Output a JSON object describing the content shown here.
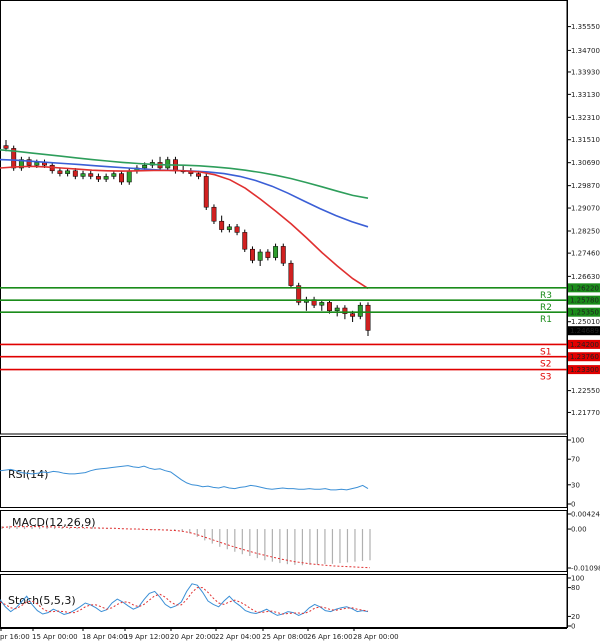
{
  "chart_data": {
    "type": "candlestick",
    "price_axis": {
      "ylim": [
        1.21,
        1.365
      ],
      "ticks": [
        "1.35550",
        "1.34700",
        "1.33930",
        "1.33130",
        "1.32310",
        "1.31510",
        "1.30690",
        "1.29870",
        "1.29070",
        "1.28250",
        "1.27460",
        "1.26630",
        "1.25010",
        "1.22550",
        "1.21770"
      ]
    },
    "time_labels": [
      "pr 16:00",
      "15 Apr 00:00",
      "18 Apr 04:00",
      "19 Apr 12:00",
      "20 Apr 20:00",
      "22 Apr 04:00",
      "25 Apr 08:00",
      "26 Apr 16:00",
      "28 Apr 00:00"
    ],
    "current_price": "1.24689",
    "levels": [
      {
        "name": "R3",
        "value": 1.2622,
        "label": "1.26220",
        "color": "#1a8c1a"
      },
      {
        "name": "R2",
        "value": 1.2578,
        "label": "1.25780",
        "color": "#1a8c1a"
      },
      {
        "name": "R1",
        "value": 1.2535,
        "label": "1.25350",
        "color": "#1a8c1a"
      },
      {
        "name": "S1",
        "value": 1.242,
        "label": "1.24200",
        "color": "#e00000"
      },
      {
        "name": "S2",
        "value": 1.2376,
        "label": "1.23760",
        "color": "#e00000"
      },
      {
        "name": "S3",
        "value": 1.233,
        "label": "1.23300",
        "color": "#e00000"
      }
    ],
    "candles": [
      [
        1.313,
        1.315,
        1.311,
        1.312
      ],
      [
        1.312,
        1.313,
        1.304,
        1.305
      ],
      [
        1.305,
        1.309,
        1.304,
        1.308
      ],
      [
        1.308,
        1.309,
        1.305,
        1.306
      ],
      [
        1.306,
        1.308,
        1.305,
        1.307
      ],
      [
        1.307,
        1.308,
        1.305,
        1.306
      ],
      [
        1.306,
        1.307,
        1.303,
        1.304
      ],
      [
        1.304,
        1.305,
        1.302,
        1.303
      ],
      [
        1.303,
        1.305,
        1.302,
        1.304
      ],
      [
        1.304,
        1.305,
        1.301,
        1.302
      ],
      [
        1.302,
        1.304,
        1.301,
        1.303
      ],
      [
        1.303,
        1.304,
        1.301,
        1.302
      ],
      [
        1.302,
        1.303,
        1.3,
        1.301
      ],
      [
        1.301,
        1.303,
        1.3,
        1.302
      ],
      [
        1.302,
        1.304,
        1.301,
        1.303
      ],
      [
        1.303,
        1.304,
        1.299,
        1.3
      ],
      [
        1.3,
        1.305,
        1.299,
        1.304
      ],
      [
        1.304,
        1.306,
        1.303,
        1.305
      ],
      [
        1.305,
        1.307,
        1.304,
        1.306
      ],
      [
        1.306,
        1.308,
        1.305,
        1.307
      ],
      [
        1.307,
        1.309,
        1.304,
        1.305
      ],
      [
        1.305,
        1.309,
        1.304,
        1.308
      ],
      [
        1.308,
        1.309,
        1.303,
        1.304
      ],
      [
        1.304,
        1.306,
        1.303,
        1.304
      ],
      [
        1.304,
        1.305,
        1.302,
        1.303
      ],
      [
        1.303,
        1.304,
        1.301,
        1.302
      ],
      [
        1.302,
        1.303,
        1.29,
        1.291
      ],
      [
        1.291,
        1.292,
        1.285,
        1.286
      ],
      [
        1.286,
        1.288,
        1.282,
        1.283
      ],
      [
        1.283,
        1.285,
        1.282,
        1.284
      ],
      [
        1.284,
        1.285,
        1.281,
        1.282
      ],
      [
        1.282,
        1.283,
        1.275,
        1.276
      ],
      [
        1.276,
        1.277,
        1.271,
        1.272
      ],
      [
        1.272,
        1.276,
        1.27,
        1.275
      ],
      [
        1.275,
        1.276,
        1.272,
        1.273
      ],
      [
        1.273,
        1.278,
        1.272,
        1.277
      ],
      [
        1.277,
        1.278,
        1.27,
        1.271
      ],
      [
        1.271,
        1.272,
        1.262,
        1.263
      ],
      [
        1.263,
        1.264,
        1.256,
        1.257
      ],
      [
        1.257,
        1.259,
        1.254,
        1.258
      ],
      [
        1.258,
        1.259,
        1.255,
        1.256
      ],
      [
        1.256,
        1.258,
        1.254,
        1.257
      ],
      [
        1.257,
        1.258,
        1.253,
        1.254
      ],
      [
        1.254,
        1.256,
        1.252,
        1.255
      ],
      [
        1.255,
        1.256,
        1.251,
        1.253
      ],
      [
        1.253,
        1.254,
        1.25,
        1.252
      ],
      [
        1.252,
        1.257,
        1.251,
        1.256
      ],
      [
        1.256,
        1.257,
        1.245,
        1.247
      ]
    ],
    "moving_averages": [
      {
        "color": "#2e9e5b",
        "values": [
          1.3115,
          1.311,
          1.3104,
          1.3098,
          1.3092,
          1.3086,
          1.308,
          1.3075,
          1.307,
          1.3066,
          1.3063,
          1.3061,
          1.306,
          1.3058,
          1.3054,
          1.3049,
          1.3042,
          1.3034,
          1.3024,
          1.3012,
          1.2998,
          1.2983,
          1.2967,
          1.2952,
          1.2942
        ]
      },
      {
        "color": "#3b5fd6",
        "values": [
          1.308,
          1.3078,
          1.3074,
          1.307,
          1.3066,
          1.3062,
          1.3058,
          1.3054,
          1.305,
          1.3046,
          1.3043,
          1.3041,
          1.3039,
          1.3036,
          1.303,
          1.302,
          1.3005,
          1.2985,
          1.296,
          1.2932,
          1.2905,
          1.288,
          1.2858,
          1.284
        ]
      },
      {
        "color": "#e03030",
        "values": [
          1.305,
          1.3054,
          1.3056,
          1.3054,
          1.305,
          1.3046,
          1.3042,
          1.304,
          1.3039,
          1.304,
          1.3041,
          1.3041,
          1.304,
          1.3036,
          1.3026,
          1.3008,
          1.2978,
          1.2938,
          1.2895,
          1.285,
          1.28,
          1.2748,
          1.27,
          1.2655,
          1.262
        ]
      }
    ],
    "rsi": {
      "title": "RSI(14)",
      "ticks": [
        "100",
        "70",
        "30",
        "0"
      ],
      "color": "#3b8fd6",
      "values": [
        52,
        53,
        54,
        52,
        49,
        48,
        47,
        48,
        50,
        49,
        51,
        50,
        48,
        47,
        47,
        48,
        49,
        52,
        54,
        55,
        56,
        57,
        58,
        59,
        60,
        58,
        57,
        59,
        56,
        54,
        55,
        52,
        50,
        44,
        38,
        33,
        30,
        29,
        27,
        28,
        26,
        25,
        27,
        25,
        24,
        26,
        27,
        29,
        28,
        26,
        24,
        23,
        24,
        25,
        24,
        24,
        23,
        23,
        24,
        23,
        23,
        24,
        22,
        22,
        23,
        22,
        24,
        26,
        29,
        24
      ]
    },
    "macd": {
      "title": "MACD(12,26,9)",
      "ticks": [
        "0.004243",
        "0.00",
        "-0.010982"
      ],
      "signal_color": "#e03030",
      "histogram": [
        0.0008,
        0.0009,
        0.0009,
        0.0008,
        0.0007,
        0.0006,
        0.0006,
        0.0005,
        0.0005,
        0.0004,
        0.0004,
        0.0003,
        0.0003,
        0.0002,
        0.0002,
        0.0001,
        0.0001,
        0.0,
        -0.0001,
        -0.0001,
        -0.0002,
        -0.0003,
        -0.0004,
        -0.0005,
        -0.0007,
        -0.0012,
        -0.0022,
        -0.0032,
        -0.0041,
        -0.005,
        -0.0057,
        -0.0064,
        -0.0071,
        -0.0076,
        -0.0082,
        -0.0088,
        -0.0092,
        -0.0096,
        -0.0099,
        -0.0101,
        -0.0102,
        -0.0101,
        -0.01,
        -0.0099,
        -0.0098,
        -0.0096,
        -0.0094,
        -0.0092,
        -0.009,
        -0.0088
      ],
      "signal": [
        0.0005,
        0.0006,
        0.0007,
        0.0007,
        0.0007,
        0.0007,
        0.0006,
        0.0006,
        0.0005,
        0.0005,
        0.0004,
        0.0004,
        0.0003,
        0.0003,
        0.0002,
        0.0002,
        0.0001,
        0.0,
        0.0,
        -0.0001,
        -0.0002,
        -0.0002,
        -0.0003,
        -0.0004,
        -0.0006,
        -0.001,
        -0.0016,
        -0.0023,
        -0.003,
        -0.0037,
        -0.0044,
        -0.0051,
        -0.0057,
        -0.0063,
        -0.0069,
        -0.0074,
        -0.0079,
        -0.0084,
        -0.0088,
        -0.0092,
        -0.0095,
        -0.0098,
        -0.01,
        -0.0102,
        -0.0104,
        -0.0105,
        -0.0106,
        -0.0107,
        -0.0108,
        -0.0109
      ]
    },
    "stoch": {
      "title": "Stoch(5,5,3)",
      "ticks": [
        "100",
        "80",
        "20",
        "0"
      ],
      "k_color": "#3b8fd6",
      "d_color": "#e03030",
      "k": [
        55,
        40,
        30,
        38,
        50,
        62,
        45,
        32,
        25,
        28,
        35,
        30,
        24,
        27,
        33,
        40,
        48,
        44,
        38,
        30,
        34,
        48,
        56,
        50,
        42,
        35,
        40,
        55,
        68,
        72,
        60,
        45,
        38,
        42,
        50,
        72,
        88,
        85,
        70,
        52,
        45,
        40,
        52,
        62,
        50,
        42,
        32,
        28,
        26,
        30,
        35,
        28,
        22,
        25,
        30,
        28,
        22,
        27,
        38,
        45,
        40,
        32,
        30,
        35,
        38,
        40,
        36,
        30,
        32,
        30
      ],
      "d": [
        50,
        45,
        38,
        36,
        42,
        50,
        52,
        46,
        36,
        30,
        30,
        31,
        30,
        28,
        28,
        33,
        40,
        44,
        44,
        40,
        35,
        38,
        45,
        50,
        50,
        44,
        40,
        45,
        54,
        63,
        66,
        60,
        50,
        44,
        44,
        55,
        70,
        80,
        80,
        70,
        58,
        48,
        45,
        50,
        54,
        50,
        44,
        36,
        30,
        28,
        30,
        31,
        28,
        25,
        26,
        27,
        27,
        26,
        30,
        37,
        40,
        38,
        34,
        33,
        35,
        37,
        38,
        35,
        33,
        31
      ]
    }
  }
}
